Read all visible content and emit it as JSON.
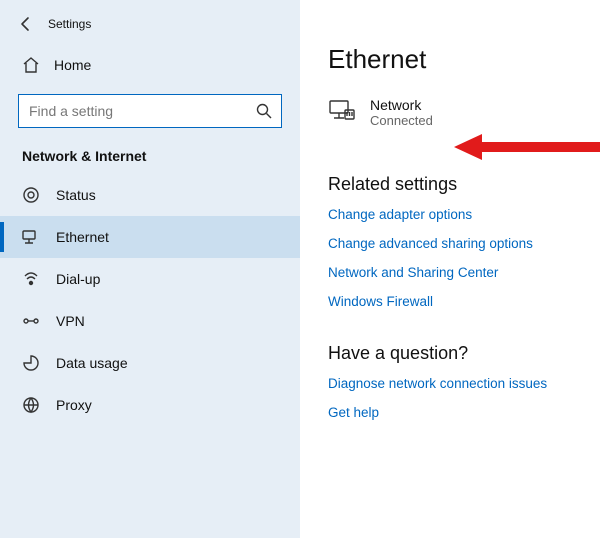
{
  "titlebar": {
    "title": "Settings"
  },
  "home": {
    "label": "Home"
  },
  "search": {
    "placeholder": "Find a setting"
  },
  "section": {
    "header": "Network & Internet"
  },
  "nav": {
    "items": [
      {
        "label": "Status"
      },
      {
        "label": "Ethernet"
      },
      {
        "label": "Dial-up"
      },
      {
        "label": "VPN"
      },
      {
        "label": "Data usage"
      },
      {
        "label": "Proxy"
      }
    ],
    "selected_index": 1
  },
  "main": {
    "title": "Ethernet",
    "network": {
      "name": "Network",
      "status": "Connected"
    },
    "related": {
      "header": "Related settings",
      "links": [
        "Change adapter options",
        "Change advanced sharing options",
        "Network and Sharing Center",
        "Windows Firewall"
      ]
    },
    "question": {
      "header": "Have a question?",
      "links": [
        "Diagnose network connection issues",
        "Get help"
      ]
    }
  }
}
